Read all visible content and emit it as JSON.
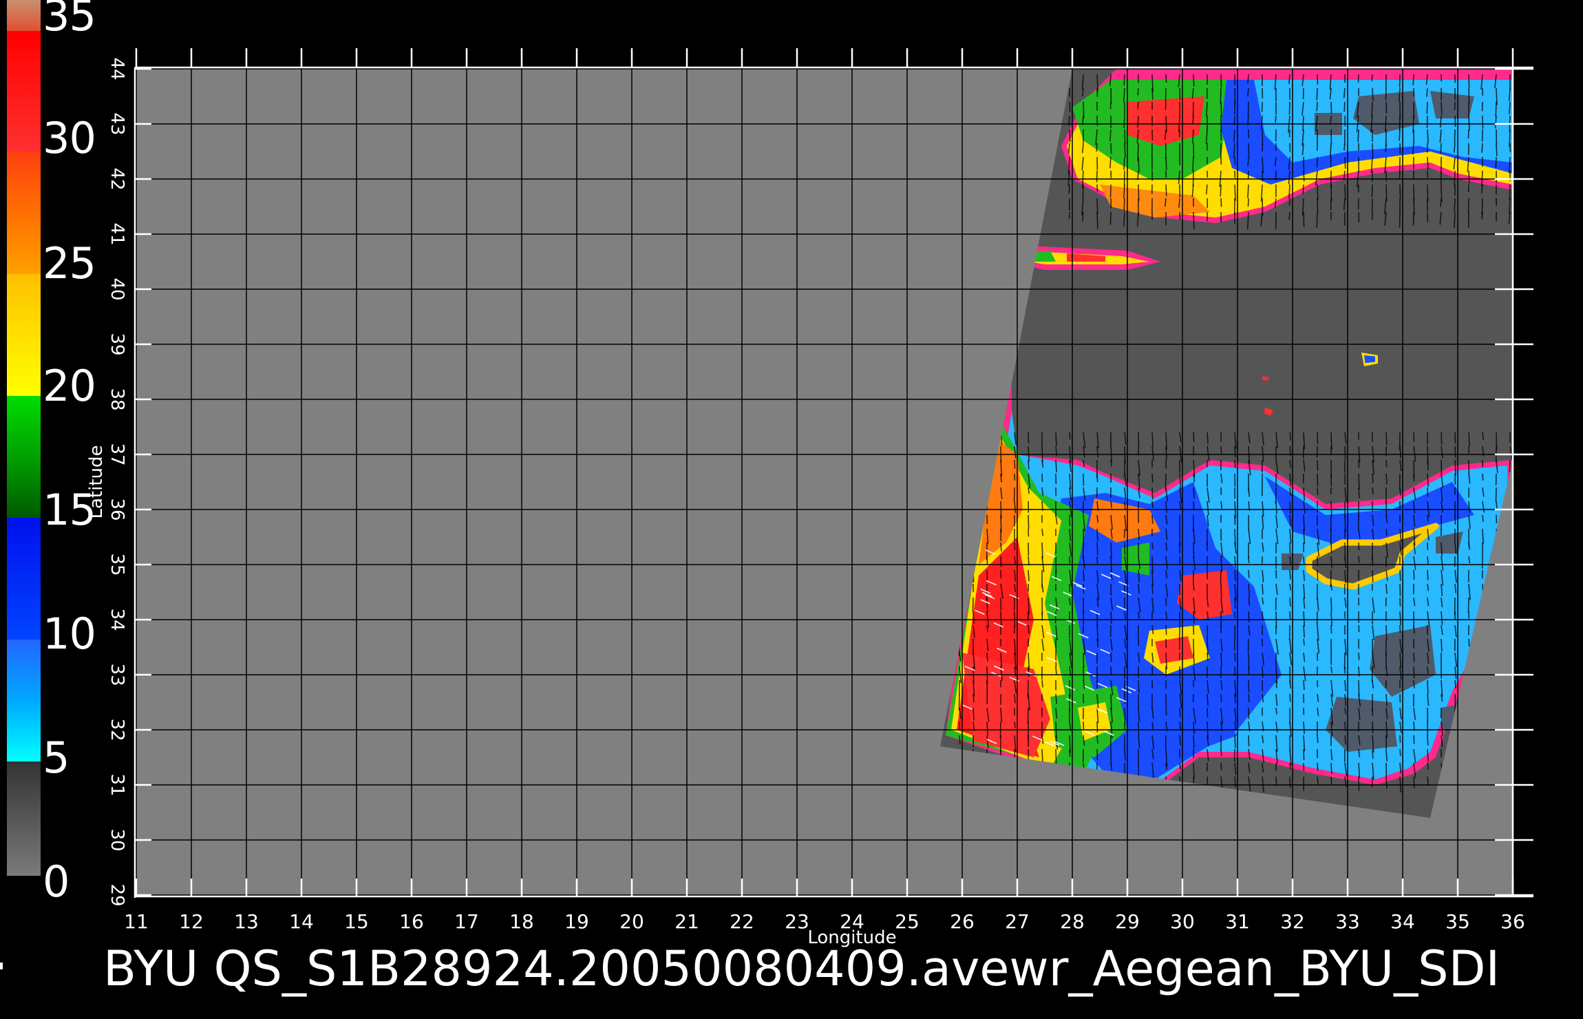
{
  "colorbar": {
    "labels": [
      "35",
      "30",
      "25",
      "20",
      "15",
      "10",
      "5",
      "0"
    ],
    "colors": {
      "c0_5": "#6e6e6e",
      "c5_10": "#00e5ff",
      "c10_15": "#0030ff",
      "c15_20": "#00c800",
      "c20_25": "#ffff00",
      "c25_30": "#ff8000",
      "c30_35": "#ff2020",
      "c35_plus": "#d08060"
    }
  },
  "axes": {
    "x_label": "Longitude",
    "y_label": "Latitude",
    "x_ticks": [
      "11",
      "12",
      "13",
      "14",
      "15",
      "16",
      "17",
      "18",
      "19",
      "20",
      "21",
      "22",
      "23",
      "24",
      "25",
      "26",
      "27",
      "28",
      "29",
      "30",
      "31",
      "32",
      "33",
      "34",
      "35",
      "36"
    ],
    "y_ticks": [
      "29",
      "30",
      "31",
      "32",
      "33",
      "34",
      "35",
      "36",
      "37",
      "38",
      "39",
      "40",
      "41",
      "42",
      "43",
      "44"
    ],
    "xlim": [
      11,
      36
    ],
    "ylim": [
      29,
      44
    ]
  },
  "title": "BYU  QS_S1B28924.20050080409.avewr_Aegean_BYU_SDI",
  "colors": {
    "land_gray": "#808080",
    "swath_gray": "#555555",
    "grid": "#000000",
    "background": "#000000"
  }
}
